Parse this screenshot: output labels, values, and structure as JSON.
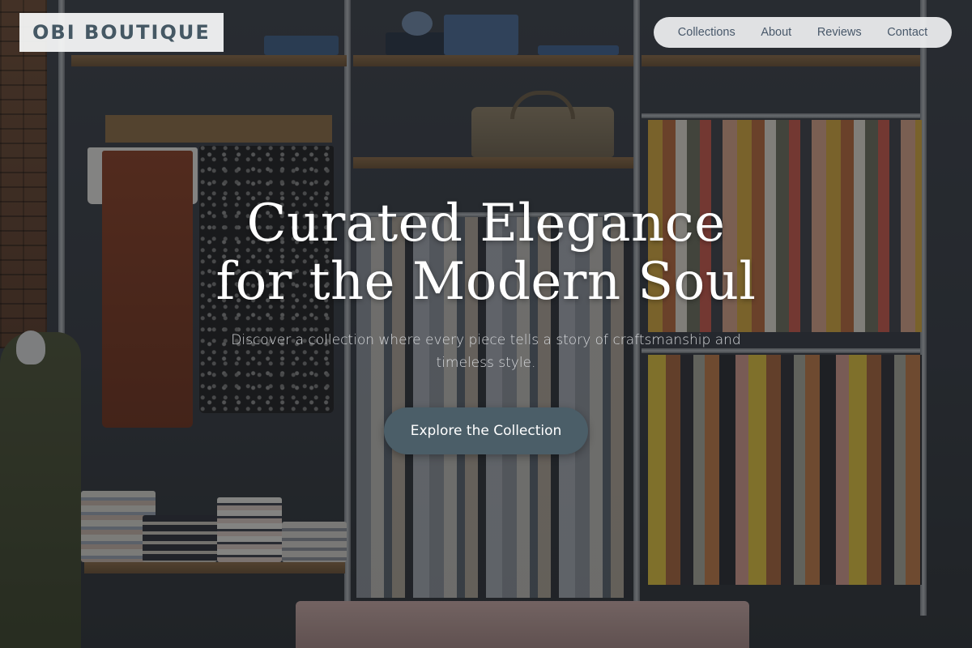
{
  "brand": {
    "name": "OBI BOUTIQUE"
  },
  "nav": {
    "items": [
      {
        "label": "Collections"
      },
      {
        "label": "About"
      },
      {
        "label": "Reviews"
      },
      {
        "label": "Contact"
      }
    ]
  },
  "hero": {
    "title_line1": "Curated Elegance",
    "title_line2": "for the Modern Soul",
    "subtitle": "Discover a collection where every piece tells a story of craftsmanship and timeless style.",
    "cta_label": "Explore the Collection",
    "background_image": "boutique-interior-photo"
  },
  "colors": {
    "brand_text": "#455864",
    "cta_background": "#4b5e68",
    "nav_text": "#48586a"
  }
}
